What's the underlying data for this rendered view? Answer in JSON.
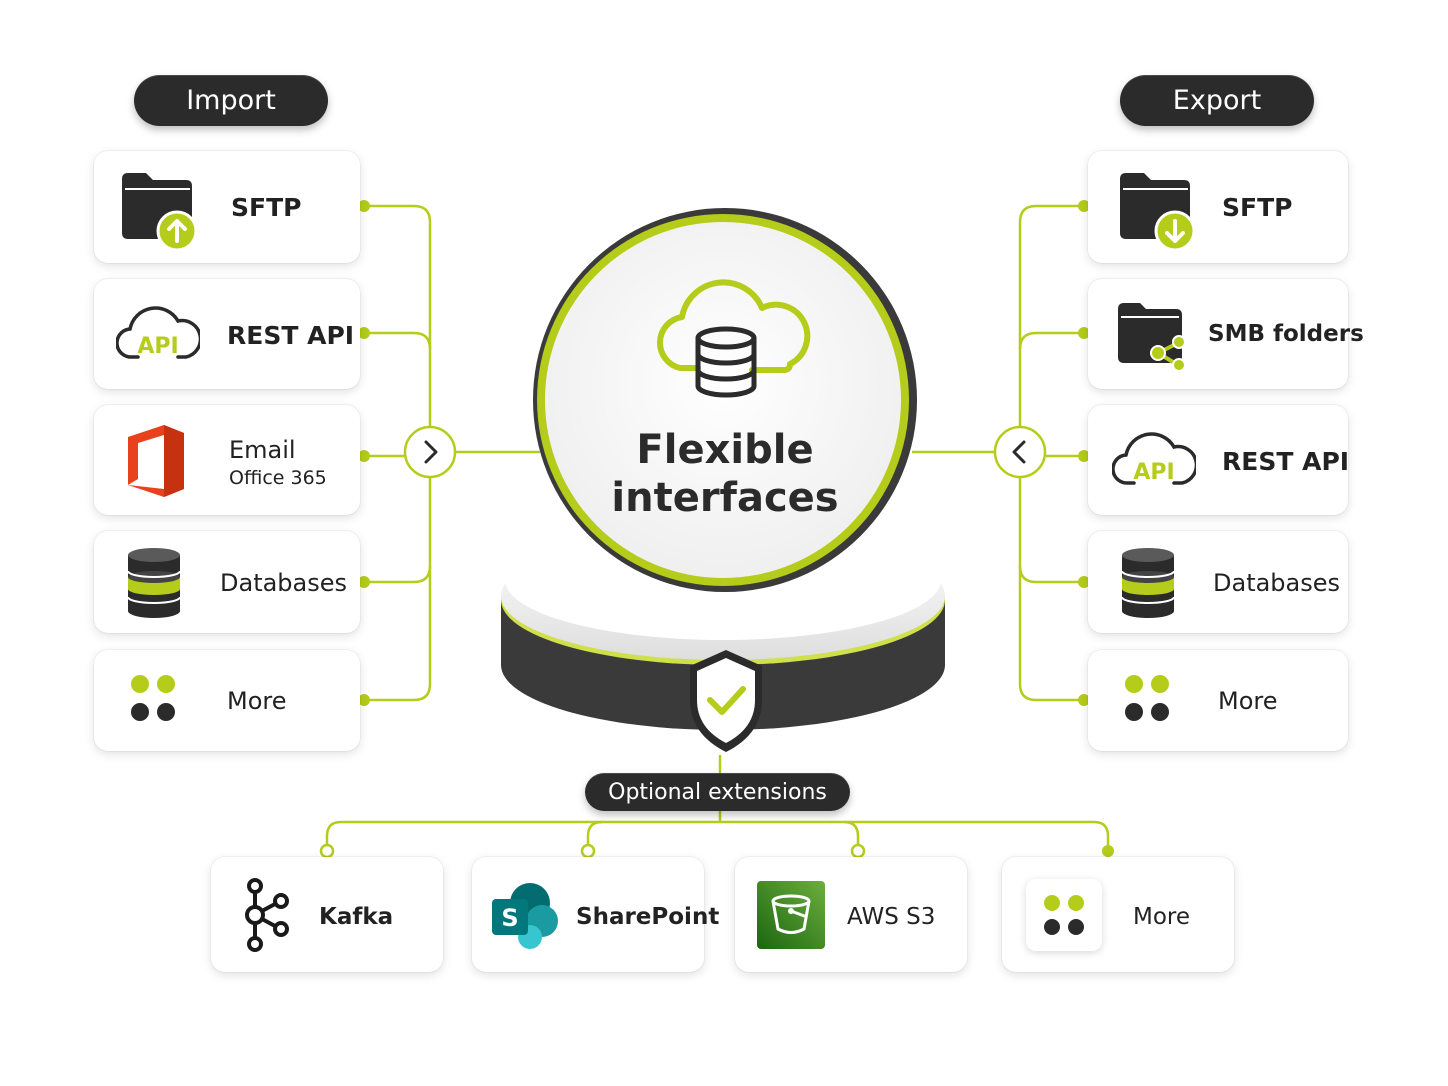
{
  "colors": {
    "accent": "#b5cc1a",
    "dark": "#2b2b2b",
    "card_bg": "#ffffff"
  },
  "import": {
    "title": "Import",
    "items": [
      {
        "label": "SFTP",
        "icon": "folder-upload-icon"
      },
      {
        "label": "REST API",
        "icon": "api-cloud-icon",
        "icon_text": "API"
      },
      {
        "label": "Email",
        "sublabel": "Office 365",
        "icon": "office365-icon"
      },
      {
        "label": "Databases",
        "icon": "database-icon"
      },
      {
        "label": "More",
        "icon": "more-dots-icon"
      }
    ]
  },
  "export": {
    "title": "Export",
    "items": [
      {
        "label": "SFTP",
        "icon": "folder-download-icon"
      },
      {
        "label": "SMB folders",
        "icon": "folder-share-icon"
      },
      {
        "label": "REST API",
        "icon": "api-cloud-icon",
        "icon_text": "API"
      },
      {
        "label": "Databases",
        "icon": "database-icon"
      },
      {
        "label": "More",
        "icon": "more-dots-icon"
      }
    ]
  },
  "center": {
    "line1": "Flexible",
    "line2": "interfaces",
    "icon": "cloud-database-icon",
    "badge_icon": "shield-check-icon"
  },
  "extensions": {
    "title": "Optional extensions",
    "items": [
      {
        "label": "Kafka",
        "icon": "kafka-icon"
      },
      {
        "label": "SharePoint",
        "icon": "sharepoint-icon",
        "icon_text": "S"
      },
      {
        "label": "AWS S3",
        "icon": "aws-s3-bucket-icon"
      },
      {
        "label": "More",
        "icon": "more-dots-icon"
      }
    ]
  }
}
